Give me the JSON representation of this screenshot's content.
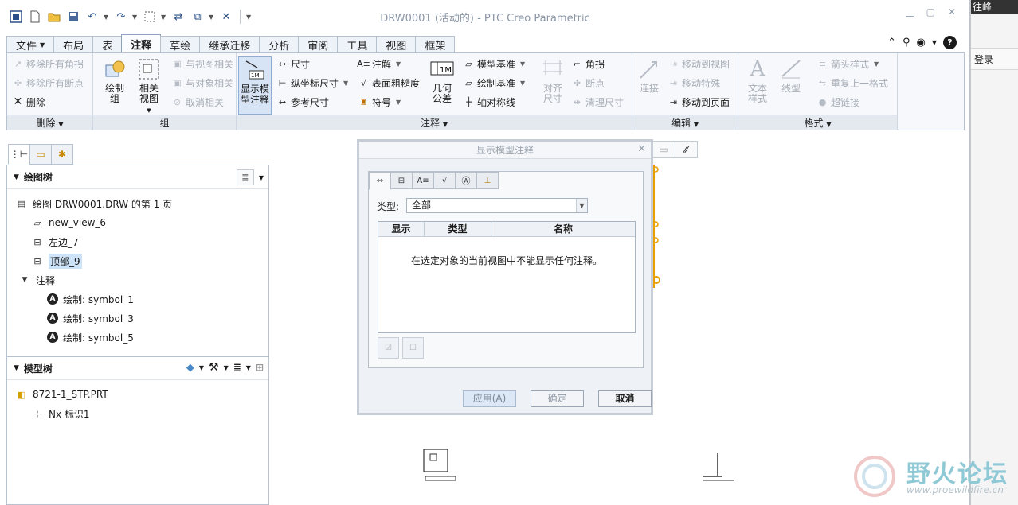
{
  "window": {
    "title": "DRW0001 (活动的) - PTC Creo Parametric"
  },
  "tabs": [
    {
      "label": "文件",
      "active": false,
      "dropdown": true
    },
    {
      "label": "布局",
      "active": false
    },
    {
      "label": "表",
      "active": false
    },
    {
      "label": "注释",
      "active": true
    },
    {
      "label": "草绘",
      "active": false
    },
    {
      "label": "继承迁移",
      "active": false
    },
    {
      "label": "分析",
      "active": false
    },
    {
      "label": "审阅",
      "active": false
    },
    {
      "label": "工具",
      "active": false
    },
    {
      "label": "视图",
      "active": false
    },
    {
      "label": "框架",
      "active": false
    }
  ],
  "ribbon": {
    "delete_group": {
      "label": "删除",
      "items": [
        {
          "label": "移除所有角拐",
          "disabled": true
        },
        {
          "label": "移除所有断点",
          "disabled": true
        },
        {
          "label": "删除",
          "disabled": false
        }
      ]
    },
    "group_group": {
      "label": "组",
      "draw_group": "绘制组",
      "related_view": "相关视图",
      "items": [
        {
          "label": "与视图相关",
          "disabled": true
        },
        {
          "label": "与对象相关",
          "disabled": true
        },
        {
          "label": "取消相关",
          "disabled": true
        }
      ]
    },
    "annotation_group": {
      "label": "注释",
      "show_model_annotations": "显示模型注释",
      "col1": [
        {
          "label": "尺寸"
        },
        {
          "label": "纵坐标尺寸"
        },
        {
          "label": "参考尺寸"
        }
      ],
      "col2": [
        {
          "label": "注解"
        },
        {
          "label": "表面粗糙度"
        },
        {
          "label": "符号"
        }
      ],
      "geometric_tolerance": "几何公差",
      "col3": [
        {
          "label": "模型基准"
        },
        {
          "label": "绘制基准"
        },
        {
          "label": "轴对称线"
        }
      ],
      "align_dims": "对齐尺寸",
      "col4": [
        {
          "label": "角拐"
        },
        {
          "label": "断点"
        },
        {
          "label": "清理尺寸"
        }
      ]
    },
    "edit_group": {
      "label": "编辑",
      "connect": "连接",
      "items": [
        {
          "label": "移动到视图",
          "disabled": true
        },
        {
          "label": "移动特殊",
          "disabled": true
        },
        {
          "label": "移动到页面",
          "disabled": false
        }
      ]
    },
    "format_group": {
      "label": "格式",
      "text_style": "文本样式",
      "line_style": "线型",
      "items": [
        {
          "label": "箭头样式",
          "disabled": true
        },
        {
          "label": "重复上一格式",
          "disabled": true
        },
        {
          "label": "超链接",
          "disabled": true
        }
      ]
    }
  },
  "drawing_tree": {
    "title": "绘图树",
    "items": [
      {
        "label": "绘图 DRW0001.DRW 的第 1 页",
        "icon": "sheet-icon"
      },
      {
        "label": "new_view_6",
        "icon": "view-icon"
      },
      {
        "label": "左边_7",
        "icon": "view-icon"
      },
      {
        "label": "顶部_9",
        "icon": "view-icon",
        "selected": true
      },
      {
        "label": "注释",
        "icon": "folder-icon"
      },
      {
        "label": "绘制: symbol_1",
        "icon": "symbol-icon"
      },
      {
        "label": "绘制: symbol_3",
        "icon": "symbol-icon"
      },
      {
        "label": "绘制: symbol_5",
        "icon": "symbol-icon"
      }
    ]
  },
  "model_tree": {
    "title": "模型树",
    "items": [
      {
        "label": "8721-1_STP.PRT",
        "icon": "part-icon"
      },
      {
        "label": "Nx 标识1",
        "icon": "feature-icon"
      }
    ]
  },
  "dialog": {
    "title": "显示模型注释",
    "type_label": "类型:",
    "type_value": "全部",
    "columns": [
      "显示",
      "类型",
      "名称"
    ],
    "empty_message": "在选定对象的当前视图中不能显示任何注释。",
    "buttons": {
      "apply": "应用(A)",
      "ok": "确定",
      "cancel": "取消"
    }
  },
  "watermark": {
    "title": "野火论坛",
    "url": "www.proewildfire.cn"
  },
  "right_panel": {
    "top_text": "往峰",
    "login": "登录"
  },
  "colors": {
    "ribbon_bg": "#f6f8fb",
    "selection": "#cde3f7",
    "accent_orange": "#e8a000"
  }
}
